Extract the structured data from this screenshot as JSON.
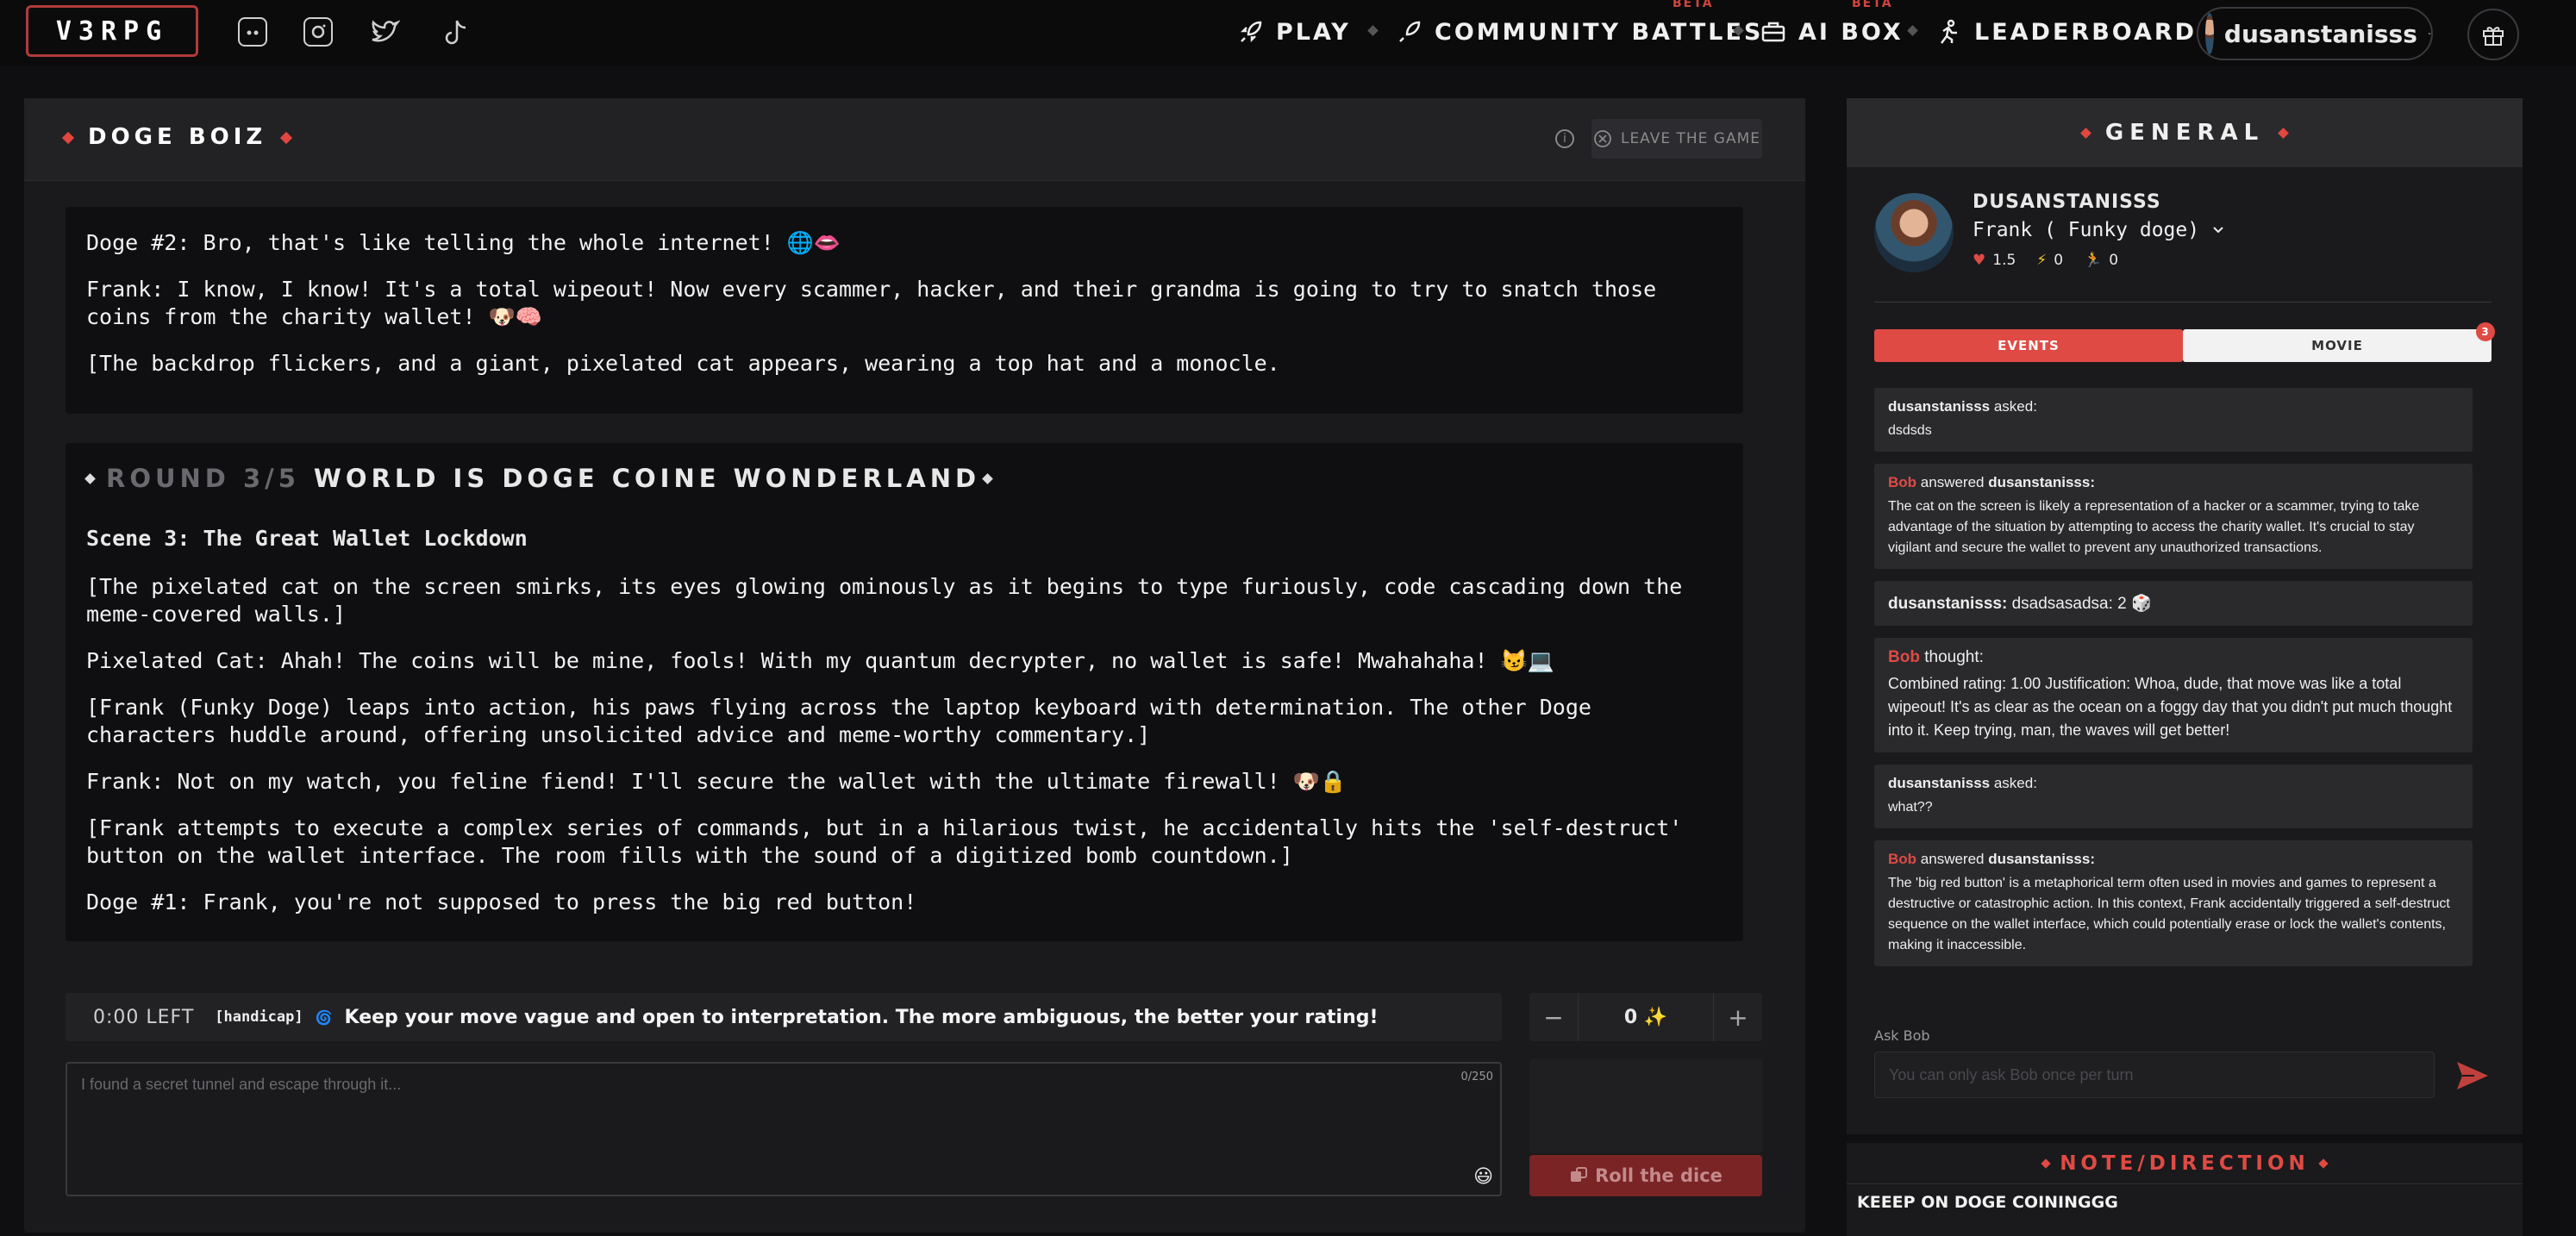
{
  "brand": {
    "logo": "V3RPG"
  },
  "nav": {
    "play": "PLAY",
    "battles": "COMMUNITY BATTLES",
    "battles_badge": "BETA",
    "aibox": "AI BOX",
    "aibox_badge": "BETA",
    "leaderboard": "LEADERBOARD"
  },
  "user": {
    "name": "dusanstanisss"
  },
  "game": {
    "title": "DOGE BOIZ",
    "leave_label": "LEAVE THE GAME",
    "story_lines": [
      "Doge #2: Bro, that's like telling the whole internet! 🌐👄",
      "Frank: I know, I know! It's a total wipeout! Now every scammer, hacker, and their grandma is going to try to snatch those coins from the charity wallet! 🐶🧠",
      "[The backdrop flickers, and a giant, pixelated cat appears, wearing a top hat and a monocle."
    ],
    "round": {
      "label": "ROUND 3/5",
      "title": "WORLD IS DOGE COINE WONDERLAND",
      "scene": "Scene 3: The Great Wallet Lockdown",
      "lines": [
        "[The pixelated cat on the screen smirks, its eyes glowing ominously as it begins to type furiously, code cascading down the meme-covered walls.]",
        "Pixelated Cat: Ahah! The coins will be mine, fools! With my quantum decrypter, no wallet is safe! Mwahahaha! 😼💻",
        "[Frank (Funky Doge) leaps into action, his paws flying across the laptop keyboard with determination. The other Doge characters huddle around, offering unsolicited advice and meme-worthy commentary.]",
        "Frank: Not on my watch, you feline fiend! I'll secure the wallet with the ultimate firewall! 🐶🔒",
        "[Frank attempts to execute a complex series of commands, but in a hilarious twist, he accidentally hits the 'self-destruct' button on the wallet interface. The room fills with the sound of a digitized bomb countdown.]",
        "Doge #1: Frank, you're not supposed to press the big red button!"
      ]
    },
    "timer": "0:00 LEFT",
    "handicap": "[handicap]",
    "hint_icon": "🌀",
    "hint": "Keep your move vague and open to interpretation. The more ambiguous, the better your rating!",
    "stepper": {
      "minus": "−",
      "value": "0 ✨",
      "plus": "+"
    },
    "move_placeholder": "I found a secret tunnel and escape through it...",
    "char_count": "0/250",
    "emoji": "😃",
    "roll_label": "Roll the dice"
  },
  "general": {
    "title": "GENERAL",
    "player_name": "DUSANSTANISSS",
    "character": "Frank ( Funky doge)",
    "stats": {
      "hearts": "1.5",
      "energy": "0",
      "runs": "0"
    },
    "tabs": {
      "events": "EVENTS",
      "movie": "MOVIE",
      "movie_badge": "3"
    },
    "events": {
      "e1_user": "dusanstanisss",
      "e1_action": "asked:",
      "e1_body": "dsdsds",
      "e2_bob": "Bob",
      "e2_action": "answered",
      "e2_user": "dusanstanisss:",
      "e2_body": "The cat on the screen is likely a representation of a hacker or a scammer, trying to take advantage of the situation by attempting to access the charity wallet. It's crucial to stay vigilant and secure the wallet to prevent any unauthorized transactions.",
      "e3_user": "dusanstanisss:",
      "e3_body": "dsadsasadsa: 2 🎲",
      "e4_bob": "Bob",
      "e4_action": "thought:",
      "e4_body": "Combined rating: 1.00 Justification: Whoa, dude, that move was like a total wipeout! It's as clear as the ocean on a foggy day that you didn't put much thought into it. Keep trying, man, the waves will get better!",
      "e5_user": "dusanstanisss",
      "e5_action": "asked:",
      "e5_body": "what??",
      "e6_bob": "Bob",
      "e6_action": "answered",
      "e6_user": "dusanstanisss:",
      "e6_body": "The 'big red button' is a metaphorical term often used in movies and games to represent a destructive or catastrophic action. In this context, Frank accidentally triggered a self-destruct sequence on the wallet interface, which could potentially erase or lock the wallet's contents, making it inaccessible."
    },
    "ask_label": "Ask Bob",
    "ask_placeholder": "You can only ask Bob once per turn"
  },
  "note": {
    "title": "NOTE/DIRECTION",
    "text": "KEEEP ON DOGE COININGGG"
  },
  "colors": {
    "accent": "#e04a44",
    "bg": "#0f0f11",
    "panel": "#1a1a1c"
  }
}
